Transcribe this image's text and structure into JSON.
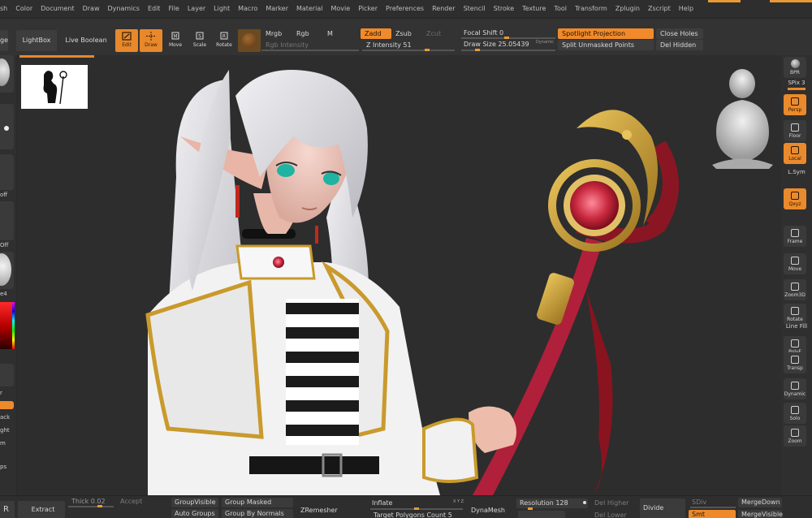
{
  "menu": [
    "sh",
    "Color",
    "Document",
    "Draw",
    "Dynamics",
    "Edit",
    "File",
    "Layer",
    "Light",
    "Macro",
    "Marker",
    "Material",
    "Movie",
    "Picker",
    "Preferences",
    "Render",
    "Stencil",
    "Stroke",
    "Texture",
    "Tool",
    "Transform",
    "Zplugin",
    "Zscript",
    "Help"
  ],
  "shelf": {
    "left_partial": "ge",
    "lightbox": "LightBox",
    "live_boolean": "Live Boolean",
    "tools": [
      {
        "label": "Edit",
        "icon": "edit-icon",
        "active": true
      },
      {
        "label": "Draw",
        "icon": "draw-icon",
        "active": true
      },
      {
        "label": "Move",
        "icon": "move-icon",
        "active": false
      },
      {
        "label": "Scale",
        "icon": "scale-icon",
        "active": false
      },
      {
        "label": "Rotate",
        "icon": "rotate-icon",
        "active": false
      }
    ],
    "mrgb": "Mrgb",
    "rgb": "Rgb",
    "m": "M",
    "rgb_intensity": "Rgb Intensity",
    "zadd": "Zadd",
    "zsub": "Zsub",
    "zcut": "Zcut",
    "z_intensity": "Z Intensity 51",
    "focal_shift": "Focal Shift 0",
    "draw_size": "Draw Size 25.05439",
    "dynamic": "Dynamic",
    "spotlight_projection": "Spotlight Projection",
    "split_unmasked_points": "Split Unmasked Points",
    "close_holes": "Close Holes",
    "del_hidden": "Del Hidden"
  },
  "left_rail": [
    "off",
    "Off",
    "e4",
    "r",
    "ack",
    "ght",
    "m",
    "ps",
    "R"
  ],
  "right_rail": {
    "bpr": "BPR",
    "spix": "SPix 3",
    "buttons": [
      {
        "label": "Persp",
        "icon": "persp-icon",
        "active": true
      },
      {
        "label": "Floor",
        "icon": "floor-icon",
        "active": false
      },
      {
        "label": "Local",
        "icon": "local-icon",
        "active": true
      },
      {
        "label": "L.Sym",
        "icon": "lsym-icon",
        "active": false
      },
      {
        "label": "Qxyz",
        "icon": "xyz-icon",
        "active": true
      },
      {
        "label": "Frame",
        "icon": "frame-icon",
        "active": false
      },
      {
        "label": "Move",
        "icon": "move-hand-icon",
        "active": false
      },
      {
        "label": "Zoom3D",
        "icon": "zoom3d-icon",
        "active": false
      },
      {
        "label": "Rotate",
        "icon": "rotate3d-icon",
        "active": false
      },
      {
        "label": "Line Fill",
        "icon": "linefill-icon",
        "active": false
      },
      {
        "label": "PolyF",
        "icon": "polyf-icon",
        "active": false
      },
      {
        "label": "Transp",
        "icon": "transp-icon",
        "active": false
      },
      {
        "label": "Dynamic",
        "icon": "dynamic-icon",
        "active": false
      },
      {
        "label": "Solo",
        "icon": "solo-icon",
        "active": false
      },
      {
        "label": "Zoom",
        "icon": "zoom-icon",
        "active": false
      }
    ]
  },
  "bottom": {
    "r": "R",
    "extract": "Extract",
    "thick": "Thick 0.02",
    "accept": "Accept",
    "group_visible": "GroupVisible",
    "group_masked": "Group Masked",
    "auto_groups": "Auto Groups",
    "group_by_normals": "Group By Normals",
    "zremesher": "ZRemesher",
    "inflate": "Inflate",
    "target_polygons": "Target Polygons Count 5",
    "xyz": "X Y Z",
    "dynamesh": "DynaMesh",
    "resolution": "Resolution 128",
    "del_higher": "Del Higher",
    "del_lower": "Del Lower",
    "divide": "Divide",
    "sdiv": "SDiv",
    "smt": "Smt",
    "merge_down": "MergeDown",
    "merge_visible": "MergeVisible"
  },
  "colors": {
    "accent": "#e8882a",
    "panel": "#333333",
    "canvas": "#2d2d2d"
  }
}
